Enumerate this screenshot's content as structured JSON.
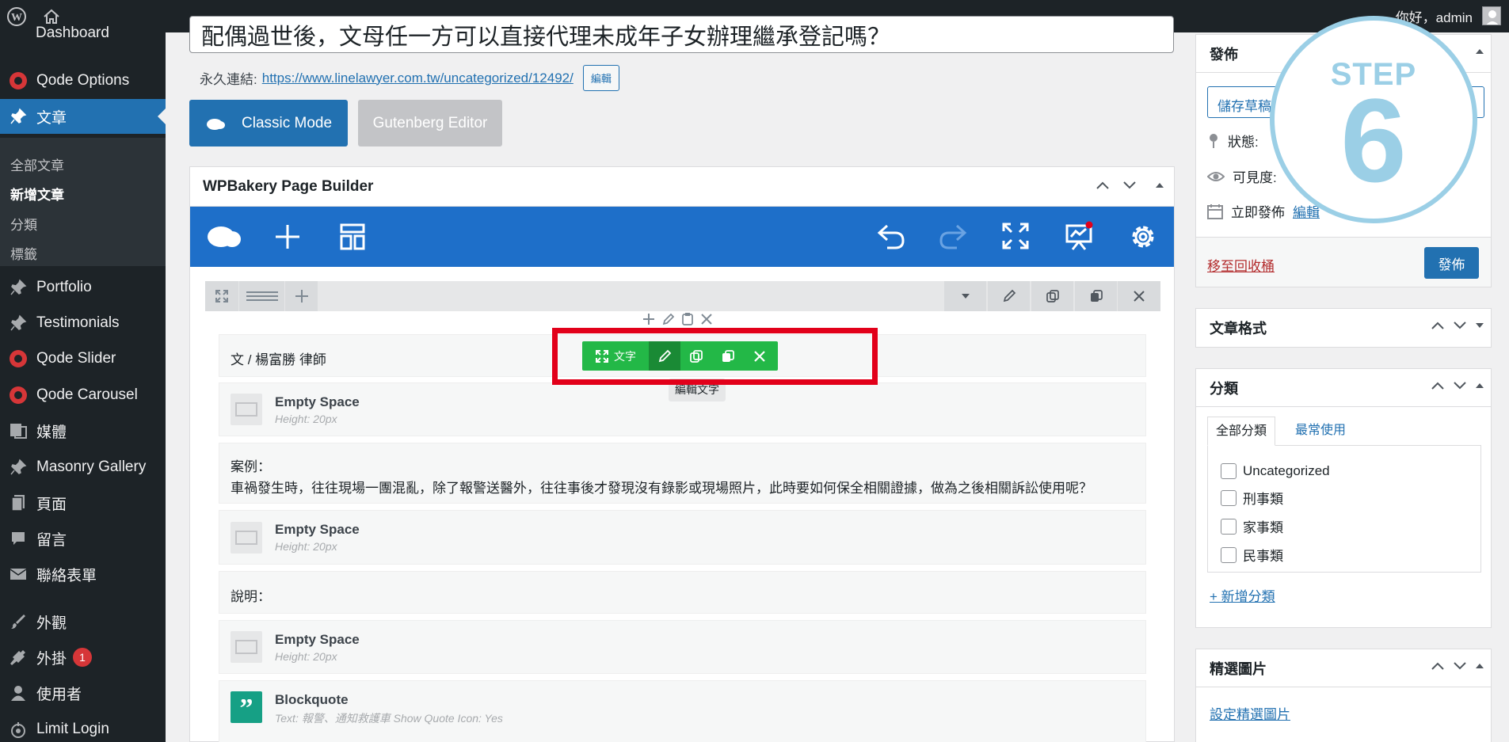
{
  "adminbar": {
    "greeting": "你好，admin"
  },
  "sidebar": {
    "dashboard_partial": "Dashboard",
    "items": [
      {
        "label": "Qode Options",
        "icon": "qode-icon"
      },
      {
        "label": "文章",
        "icon": "pin-icon"
      },
      {
        "label": "Portfolio",
        "icon": "pin-icon"
      },
      {
        "label": "Testimonials",
        "icon": "pin-icon"
      },
      {
        "label": "Qode Slider",
        "icon": "qode-icon"
      },
      {
        "label": "Qode Carousel",
        "icon": "qode-icon"
      },
      {
        "label": "媒體",
        "icon": "media-icon"
      },
      {
        "label": "Masonry Gallery",
        "icon": "pin-icon"
      },
      {
        "label": "頁面",
        "icon": "page-icon"
      },
      {
        "label": "留言",
        "icon": "comment-icon"
      },
      {
        "label": "聯絡表單",
        "icon": "mail-icon"
      },
      {
        "label": "外觀",
        "icon": "brush-icon"
      },
      {
        "label": "外掛",
        "icon": "plugin-icon",
        "badge": "1"
      },
      {
        "label": "使用者",
        "icon": "user-icon"
      },
      {
        "label": "Limit Login",
        "icon": "limit-login-icon"
      }
    ],
    "submenu": [
      "全部文章",
      "新增文章",
      "分類",
      "標籤"
    ]
  },
  "editor": {
    "title_value": "配偶過世後，文母任一方可以直接代理未成年子女辦理繼承登記嗎？",
    "permalink_label": "永久連結:",
    "permalink_url": "https://www.linelawyer.com.tw/uncategorized/12492/",
    "permalink_edit": "編輯",
    "classic_mode": "Classic Mode",
    "gutenberg_editor": "Gutenberg Editor"
  },
  "wpbakery": {
    "title": "WPBakery Page Builder",
    "elements": [
      {
        "type": "text",
        "text": "文 / 楊富勝 律師"
      },
      {
        "type": "empty",
        "name": "Empty Space",
        "desc": "Height: 20px"
      },
      {
        "type": "text2",
        "line1": "案例：",
        "line2": "車禍發生時，往往現場一團混亂，除了報警送醫外，往往事後才發現沒有錄影或現場照片，此時要如何保全相關證據，做為之後相關訴訟使用呢？"
      },
      {
        "type": "empty",
        "name": "Empty Space",
        "desc": "Height: 20px"
      },
      {
        "type": "text",
        "text": "說明："
      },
      {
        "type": "empty",
        "name": "Empty Space",
        "desc": "Height: 20px"
      },
      {
        "type": "quote",
        "name": "Blockquote",
        "desc": "Text: 報警、通知救護車 Show Quote Icon: Yes"
      }
    ],
    "element_toolbar_label": "文字",
    "tooltip": "編輯文字",
    "highlight_color": "#e2001a",
    "toolbar_color": "#23b847",
    "navbar_color": "#1e6fc9"
  },
  "publish": {
    "title": "發佈",
    "save_draft": "儲存草稿",
    "status_label": "狀態:",
    "visibility_label": "可見度:",
    "publish_time": "立即發佈",
    "edit_link": "編輯",
    "trash": "移至回收桶",
    "publish_button": "發佈"
  },
  "step": {
    "word": "STEP",
    "number": "6",
    "color": "#9bcfe6"
  },
  "post_format": {
    "title": "文章格式"
  },
  "categories": {
    "title": "分類",
    "tab_all": "全部分類",
    "tab_popular": "最常使用",
    "items": [
      "Uncategorized",
      "刑事類",
      "家事類",
      "民事類"
    ],
    "add_new": "+ 新增分類"
  },
  "featured_image": {
    "title": "精選圖片",
    "set_link": "設定精選圖片"
  },
  "colors": {
    "admin_bg": "#1d2327",
    "accent": "#2271b1",
    "danger": "#d63638"
  }
}
